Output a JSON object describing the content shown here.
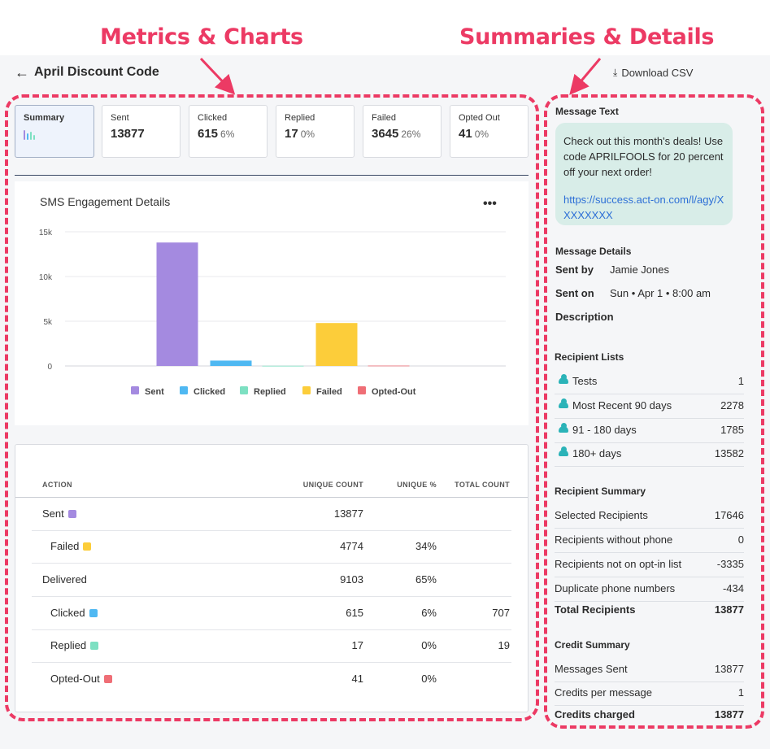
{
  "annotations": {
    "left_title": "Metrics & Charts",
    "right_title": "Summaries & Details"
  },
  "header": {
    "title": "April Discount Code",
    "download_label": "Download CSV"
  },
  "metric_cards": [
    {
      "label": "Summary",
      "value": "",
      "pct": "",
      "active": true
    },
    {
      "label": "Sent",
      "value": "13877",
      "pct": ""
    },
    {
      "label": "Clicked",
      "value": "615",
      "pct": "6%"
    },
    {
      "label": "Replied",
      "value": "17",
      "pct": "0%"
    },
    {
      "label": "Failed",
      "value": "3645",
      "pct": "26%"
    },
    {
      "label": "Opted Out",
      "value": "41",
      "pct": "0%"
    }
  ],
  "chart": {
    "menu_label": "•••"
  },
  "chart_data": {
    "type": "bar",
    "title": "SMS Engagement Details",
    "categories": [
      "Sent",
      "Clicked",
      "Replied",
      "Failed",
      "Opted-Out"
    ],
    "values": [
      13800,
      600,
      20,
      4800,
      40
    ],
    "colors": [
      "#a48ae0",
      "#4fb8f2",
      "#7de0c2",
      "#fccd3a",
      "#ef6e76"
    ],
    "ylim": [
      0,
      15000
    ],
    "yticks": [
      0,
      5000,
      10000,
      15000
    ],
    "ytick_labels": [
      "0",
      "5k",
      "10k",
      "15k"
    ],
    "grid": true,
    "legend": [
      "Sent",
      "Clicked",
      "Replied",
      "Failed",
      "Opted-Out"
    ],
    "legend_position": "bottom",
    "xlabel": "",
    "ylabel": ""
  },
  "table": {
    "headers": [
      "ACTION",
      "UNIQUE COUNT",
      "UNIQUE %",
      "TOTAL COUNT"
    ],
    "rows": [
      {
        "action": "Sent",
        "indent": false,
        "swatch": "#a48ae0",
        "unique_count": "13877",
        "unique_pct": "",
        "total_count": ""
      },
      {
        "action": "Failed",
        "indent": true,
        "swatch": "#fccd3a",
        "unique_count": "4774",
        "unique_pct": "34%",
        "total_count": ""
      },
      {
        "action": "Delivered",
        "indent": false,
        "swatch": "",
        "unique_count": "9103",
        "unique_pct": "65%",
        "total_count": ""
      },
      {
        "action": "Clicked",
        "indent": true,
        "swatch": "#4fb8f2",
        "unique_count": "615",
        "unique_pct": "6%",
        "total_count": "707"
      },
      {
        "action": "Replied",
        "indent": true,
        "swatch": "#7de0c2",
        "unique_count": "17",
        "unique_pct": "0%",
        "total_count": "19"
      },
      {
        "action": "Opted-Out",
        "indent": true,
        "swatch": "#ef6e76",
        "unique_count": "41",
        "unique_pct": "0%",
        "total_count": ""
      }
    ]
  },
  "side": {
    "message_text_heading": "Message Text",
    "message_body": "Check out this month's deals! Use code APRILFOOLS for 20 percent off your next order!",
    "message_link": "https://success.act-on.com/l/agy/XXXXXXXX",
    "details_heading": "Message Details",
    "sent_by_label": "Sent by",
    "sent_by_value": "Jamie Jones",
    "sent_on_label": "Sent on",
    "sent_on_value": "Sun • Apr  1  • 8:00 am",
    "description_label": "Description",
    "lists_heading": "Recipient Lists",
    "lists": [
      {
        "name": "Tests",
        "count": "1"
      },
      {
        "name": "Most Recent 90 days",
        "count": "2278"
      },
      {
        "name": "91 - 180 days",
        "count": "1785"
      },
      {
        "name": "180+ days",
        "count": "13582"
      }
    ],
    "recipient_summary_heading": "Recipient Summary",
    "recipient_summary": [
      {
        "label": "Selected Recipients",
        "value": "17646"
      },
      {
        "label": "Recipients without phone",
        "value": "0"
      },
      {
        "label": "Recipients not on opt-in list",
        "value": "-3335"
      },
      {
        "label": "Duplicate phone numbers",
        "value": "-434"
      },
      {
        "label": "Total Recipients",
        "value": "13877"
      }
    ],
    "credit_summary_heading": "Credit Summary",
    "credit_summary": [
      {
        "label": "Messages Sent",
        "value": "13877"
      },
      {
        "label": "Credits per message",
        "value": "1"
      },
      {
        "label": "Credits charged",
        "value": "13877"
      }
    ]
  }
}
